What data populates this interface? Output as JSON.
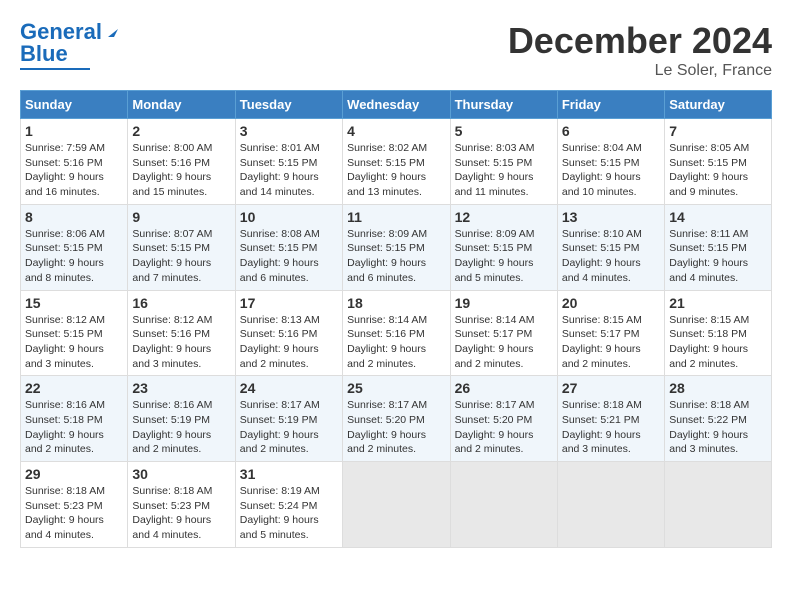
{
  "header": {
    "logo": {
      "line1": "General",
      "line2": "Blue"
    },
    "title": "December 2024",
    "subtitle": "Le Soler, France"
  },
  "calendar": {
    "days_of_week": [
      "Sunday",
      "Monday",
      "Tuesday",
      "Wednesday",
      "Thursday",
      "Friday",
      "Saturday"
    ],
    "weeks": [
      [
        null,
        null,
        null,
        null,
        null,
        null,
        null
      ]
    ],
    "cells": [
      {
        "date": 1,
        "dow": 0,
        "sunrise": "7:59 AM",
        "sunset": "5:16 PM",
        "daylight": "9 hours and 16 minutes."
      },
      {
        "date": 2,
        "dow": 1,
        "sunrise": "8:00 AM",
        "sunset": "5:16 PM",
        "daylight": "9 hours and 15 minutes."
      },
      {
        "date": 3,
        "dow": 2,
        "sunrise": "8:01 AM",
        "sunset": "5:15 PM",
        "daylight": "9 hours and 14 minutes."
      },
      {
        "date": 4,
        "dow": 3,
        "sunrise": "8:02 AM",
        "sunset": "5:15 PM",
        "daylight": "9 hours and 13 minutes."
      },
      {
        "date": 5,
        "dow": 4,
        "sunrise": "8:03 AM",
        "sunset": "5:15 PM",
        "daylight": "9 hours and 11 minutes."
      },
      {
        "date": 6,
        "dow": 5,
        "sunrise": "8:04 AM",
        "sunset": "5:15 PM",
        "daylight": "9 hours and 10 minutes."
      },
      {
        "date": 7,
        "dow": 6,
        "sunrise": "8:05 AM",
        "sunset": "5:15 PM",
        "daylight": "9 hours and 9 minutes."
      },
      {
        "date": 8,
        "dow": 0,
        "sunrise": "8:06 AM",
        "sunset": "5:15 PM",
        "daylight": "9 hours and 8 minutes."
      },
      {
        "date": 9,
        "dow": 1,
        "sunrise": "8:07 AM",
        "sunset": "5:15 PM",
        "daylight": "9 hours and 7 minutes."
      },
      {
        "date": 10,
        "dow": 2,
        "sunrise": "8:08 AM",
        "sunset": "5:15 PM",
        "daylight": "9 hours and 6 minutes."
      },
      {
        "date": 11,
        "dow": 3,
        "sunrise": "8:09 AM",
        "sunset": "5:15 PM",
        "daylight": "9 hours and 6 minutes."
      },
      {
        "date": 12,
        "dow": 4,
        "sunrise": "8:09 AM",
        "sunset": "5:15 PM",
        "daylight": "9 hours and 5 minutes."
      },
      {
        "date": 13,
        "dow": 5,
        "sunrise": "8:10 AM",
        "sunset": "5:15 PM",
        "daylight": "9 hours and 4 minutes."
      },
      {
        "date": 14,
        "dow": 6,
        "sunrise": "8:11 AM",
        "sunset": "5:15 PM",
        "daylight": "9 hours and 4 minutes."
      },
      {
        "date": 15,
        "dow": 0,
        "sunrise": "8:12 AM",
        "sunset": "5:15 PM",
        "daylight": "9 hours and 3 minutes."
      },
      {
        "date": 16,
        "dow": 1,
        "sunrise": "8:12 AM",
        "sunset": "5:16 PM",
        "daylight": "9 hours and 3 minutes."
      },
      {
        "date": 17,
        "dow": 2,
        "sunrise": "8:13 AM",
        "sunset": "5:16 PM",
        "daylight": "9 hours and 2 minutes."
      },
      {
        "date": 18,
        "dow": 3,
        "sunrise": "8:14 AM",
        "sunset": "5:16 PM",
        "daylight": "9 hours and 2 minutes."
      },
      {
        "date": 19,
        "dow": 4,
        "sunrise": "8:14 AM",
        "sunset": "5:17 PM",
        "daylight": "9 hours and 2 minutes."
      },
      {
        "date": 20,
        "dow": 5,
        "sunrise": "8:15 AM",
        "sunset": "5:17 PM",
        "daylight": "9 hours and 2 minutes."
      },
      {
        "date": 21,
        "dow": 6,
        "sunrise": "8:15 AM",
        "sunset": "5:18 PM",
        "daylight": "9 hours and 2 minutes."
      },
      {
        "date": 22,
        "dow": 0,
        "sunrise": "8:16 AM",
        "sunset": "5:18 PM",
        "daylight": "9 hours and 2 minutes."
      },
      {
        "date": 23,
        "dow": 1,
        "sunrise": "8:16 AM",
        "sunset": "5:19 PM",
        "daylight": "9 hours and 2 minutes."
      },
      {
        "date": 24,
        "dow": 2,
        "sunrise": "8:17 AM",
        "sunset": "5:19 PM",
        "daylight": "9 hours and 2 minutes."
      },
      {
        "date": 25,
        "dow": 3,
        "sunrise": "8:17 AM",
        "sunset": "5:20 PM",
        "daylight": "9 hours and 2 minutes."
      },
      {
        "date": 26,
        "dow": 4,
        "sunrise": "8:17 AM",
        "sunset": "5:20 PM",
        "daylight": "9 hours and 2 minutes."
      },
      {
        "date": 27,
        "dow": 5,
        "sunrise": "8:18 AM",
        "sunset": "5:21 PM",
        "daylight": "9 hours and 3 minutes."
      },
      {
        "date": 28,
        "dow": 6,
        "sunrise": "8:18 AM",
        "sunset": "5:22 PM",
        "daylight": "9 hours and 3 minutes."
      },
      {
        "date": 29,
        "dow": 0,
        "sunrise": "8:18 AM",
        "sunset": "5:23 PM",
        "daylight": "9 hours and 4 minutes."
      },
      {
        "date": 30,
        "dow": 1,
        "sunrise": "8:18 AM",
        "sunset": "5:23 PM",
        "daylight": "9 hours and 4 minutes."
      },
      {
        "date": 31,
        "dow": 2,
        "sunrise": "8:19 AM",
        "sunset": "5:24 PM",
        "daylight": "9 hours and 5 minutes."
      }
    ]
  }
}
